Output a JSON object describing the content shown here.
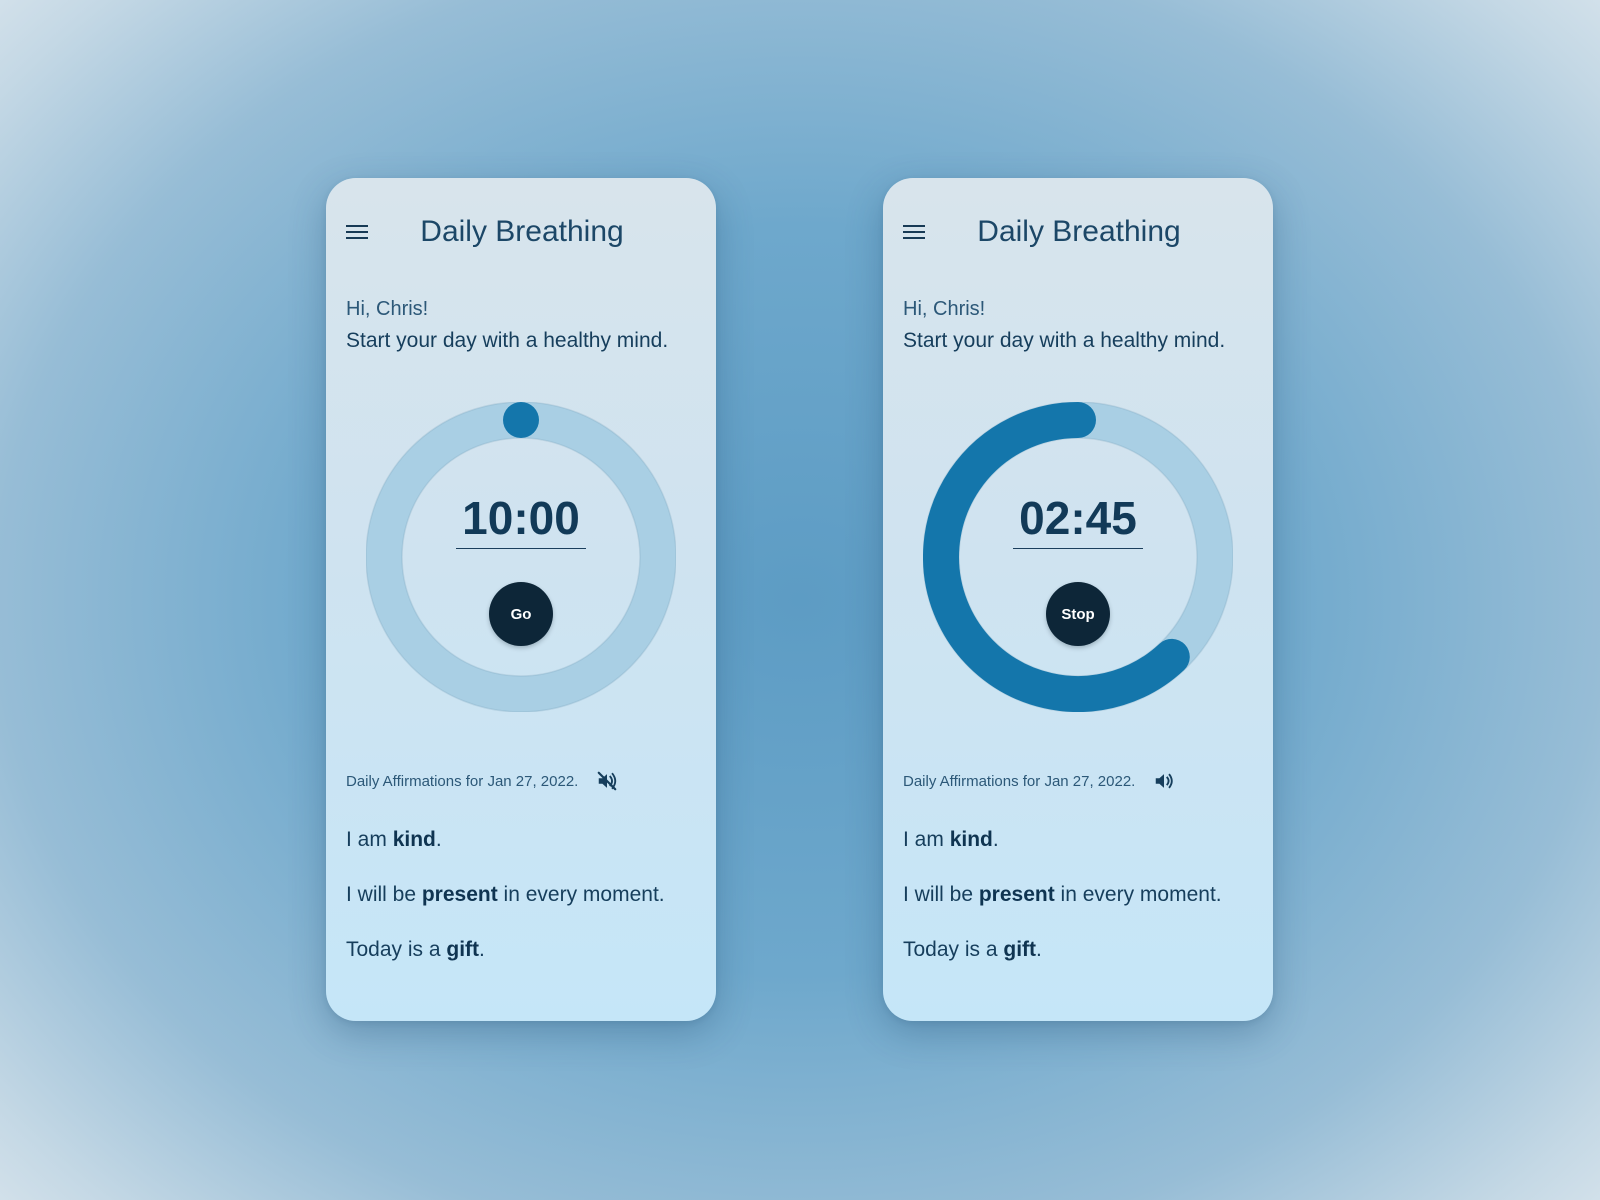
{
  "screens": [
    {
      "title": "Daily Breathing",
      "greeting": "Hi, Chris!",
      "subtitle": "Start your day with a healthy mind.",
      "timer": "10:00",
      "progress": 0,
      "action_label": "Go",
      "affirmations_heading": "Daily Affirmations for Jan 27, 2022.",
      "sound_icon": "speaker-muted-icon",
      "affirmations": [
        {
          "before": "I am ",
          "bold": "kind",
          "after": "."
        },
        {
          "before": "I will be ",
          "bold": "present",
          "after": " in every moment."
        },
        {
          "before": "Today is a ",
          "bold": "gift",
          "after": "."
        }
      ]
    },
    {
      "title": "Daily Breathing",
      "greeting": "Hi, Chris!",
      "subtitle": "Start your day with a healthy mind.",
      "timer": "02:45",
      "progress": 0.62,
      "action_label": "Stop",
      "affirmations_heading": "Daily Affirmations for Jan 27, 2022.",
      "sound_icon": "speaker-on-icon",
      "affirmations": [
        {
          "before": "I am ",
          "bold": "kind",
          "after": "."
        },
        {
          "before": "I will be ",
          "bold": "present",
          "after": " in every moment."
        },
        {
          "before": "Today is a ",
          "bold": "gift",
          "after": "."
        }
      ]
    }
  ],
  "colors": {
    "ring_track": "#a9cfe4",
    "ring_progress": "#1476ab",
    "button": "#0d2638",
    "text_dark": "#123a58"
  }
}
